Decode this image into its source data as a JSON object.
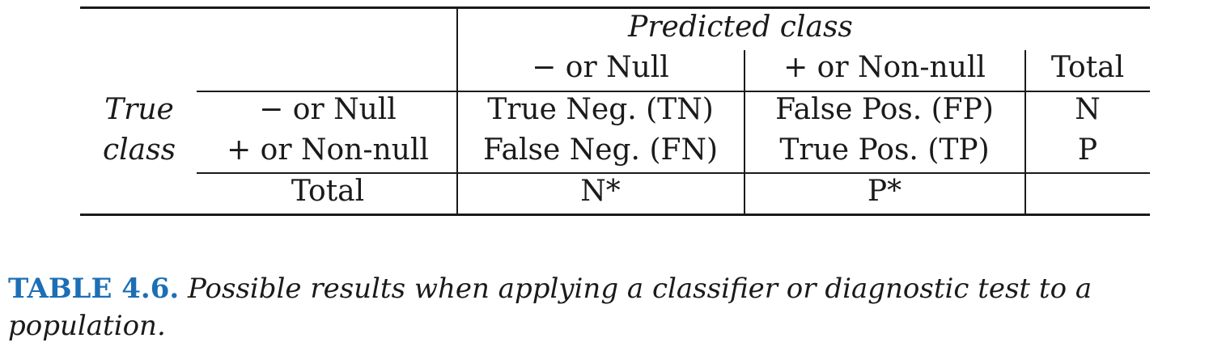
{
  "table": {
    "predicted_header": "Predicted class",
    "col_headers": [
      "− or Null",
      "+ or Non-null",
      "Total"
    ],
    "true_label_line1": "True",
    "true_label_line2": "class",
    "rows": [
      {
        "label": "− or Null",
        "cells": [
          "True Neg. (TN)",
          "False Pos. (FP)",
          "N"
        ]
      },
      {
        "label": "+ or Non-null",
        "cells": [
          "False Neg. (FN)",
          "True Pos. (TP)",
          "P"
        ]
      }
    ],
    "total_row": {
      "label": "Total",
      "cells": [
        "N*",
        "P*",
        ""
      ]
    }
  },
  "caption": {
    "label": "TABLE 4.6.",
    "text": "Possible results when applying a classifier or diagnostic test to a population."
  }
}
